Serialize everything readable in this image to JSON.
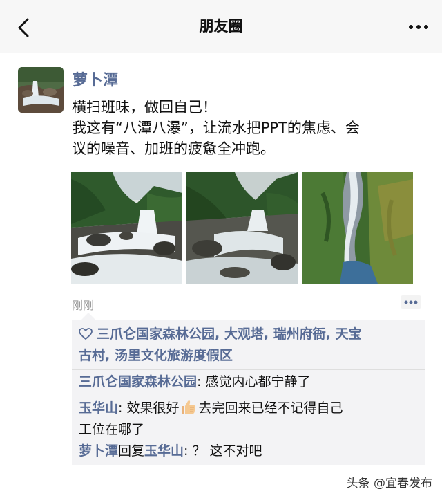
{
  "header": {
    "title": "朋友圈",
    "back_icon": "chevron-left-icon",
    "more_icon": "more-horizontal-icon"
  },
  "post": {
    "username": "萝卜潭",
    "text_lines": [
      "横扫班味，做回自己！",
      "我这有“八潭八瀑”，让流水把PPT的焦虑、会",
      "议的噪音、加班的疲惫全冲跑。"
    ],
    "timestamp": "刚刚",
    "photos": [
      "waterfall-photo",
      "waterfall-photo",
      "aerial-waterfall-photo"
    ]
  },
  "likes": {
    "icon": "heart-icon",
    "names": [
      "三爪仑国家森林公园",
      "大观塔",
      "瑞州府衙",
      "天宝古村",
      "汤里文化旅游度假区"
    ],
    "line1": [
      "三爪仑国家森林公园",
      "大观塔",
      "瑞州府衙",
      "天宝"
    ],
    "line2_start": "古村",
    "separator": ", "
  },
  "comments": [
    {
      "author": "三爪仑国家森林公园",
      "colon": ": ",
      "text": "感觉内心都宁静了"
    },
    {
      "author": "玉华山",
      "colon": ": ",
      "text_before_emoji": "效果很好",
      "emoji": "thumbs-up-icon",
      "text_after_emoji": "去完回来已经不记得自己",
      "text_line2": "工位在哪了"
    },
    {
      "author": "萝卜潭",
      "reply_word": "回复",
      "reply_to": "玉华山",
      "colon": ": ",
      "text": "？ 这不对吧"
    }
  ],
  "watermark": "头条 @宜春发布",
  "colors": {
    "link_blue": "#576b95",
    "header_bg": "#f7f7f7",
    "interaction_bg": "#f3f3f5",
    "timestamp_gray": "#9a9a9a"
  }
}
